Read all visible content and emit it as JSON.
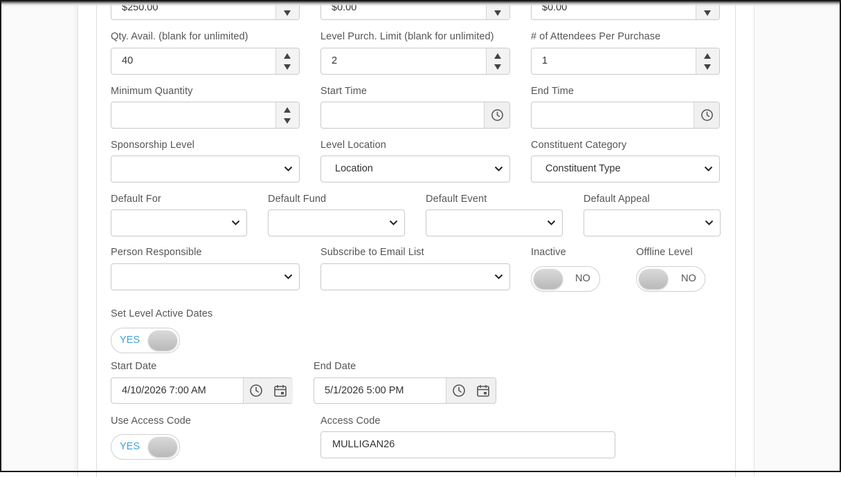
{
  "top_row": {
    "price_value": "$250.00",
    "field2_value": "$0.00",
    "field3_value": "$0.00"
  },
  "qty_avail": {
    "label": "Qty. Avail. (blank for unlimited)",
    "value": "40"
  },
  "purch_limit": {
    "label": "Level Purch. Limit (blank for unlimited)",
    "value": "2"
  },
  "attendees": {
    "label": "# of Attendees Per Purchase",
    "value": "1"
  },
  "min_qty": {
    "label": "Minimum Quantity",
    "value": ""
  },
  "start_time": {
    "label": "Start Time",
    "value": ""
  },
  "end_time": {
    "label": "End Time",
    "value": ""
  },
  "sponsorship_level": {
    "label": "Sponsorship Level",
    "value": ""
  },
  "level_location": {
    "label": "Level Location",
    "value": "Location"
  },
  "constituent_category": {
    "label": "Constituent Category",
    "value": "Constituent Type"
  },
  "default_for": {
    "label": "Default For",
    "value": ""
  },
  "default_fund": {
    "label": "Default Fund",
    "value": ""
  },
  "default_event": {
    "label": "Default Event",
    "value": ""
  },
  "default_appeal": {
    "label": "Default Appeal",
    "value": ""
  },
  "person_responsible": {
    "label": "Person Responsible",
    "value": ""
  },
  "subscribe_email": {
    "label": "Subscribe to Email List",
    "value": ""
  },
  "inactive": {
    "label": "Inactive",
    "state": "NO"
  },
  "offline_level": {
    "label": "Offline Level",
    "state": "NO"
  },
  "set_active_dates": {
    "label": "Set Level Active Dates",
    "state": "YES"
  },
  "start_date": {
    "label": "Start Date",
    "value": "4/10/2026 7:00 AM"
  },
  "end_date": {
    "label": "End Date",
    "value": "5/1/2026 5:00 PM"
  },
  "use_access_code": {
    "label": "Use Access Code",
    "state": "YES"
  },
  "access_code": {
    "label": "Access Code",
    "value": "MULLIGAN26"
  },
  "colors": {
    "toggle_yes": "#3aa3d8",
    "label": "#555555",
    "border": "#c9c9c9",
    "addon_bg": "#f0f0f0"
  }
}
